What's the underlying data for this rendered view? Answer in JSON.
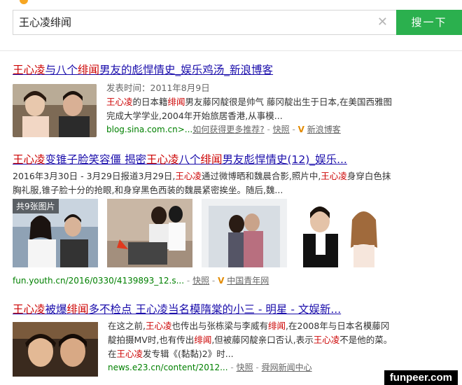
{
  "search": {
    "query": "王心凌绯闻",
    "button_label": "搜一下"
  },
  "results": [
    {
      "title_parts": [
        {
          "text": "王心凌",
          "hl": true
        },
        {
          "text": "与八个",
          "hl": false
        },
        {
          "text": "绯闻",
          "hl": true
        },
        {
          "text": "男友的彪悍情史_娱乐鸡汤_新浪博客",
          "hl": false
        }
      ],
      "date_line": "发表时间：2011年8月9日",
      "snippet_parts": [
        {
          "text": "王心凌",
          "hl": true
        },
        {
          "text": "的日本籍",
          "hl": false
        },
        {
          "text": "绯闻",
          "hl": true
        },
        {
          "text": "男友藤冈靛很是帅气 藤冈靛出生于日本,在美国西雅图完成大学学业,2004年开始旅居香港,从事模...",
          "hl": false
        }
      ],
      "url": "blog.sina.com.cn>...",
      "extra_link": "如何获得更多推荐?",
      "cache": "快照",
      "source": "新浪博客"
    },
    {
      "title_parts": [
        {
          "text": "王心凌",
          "hl": true
        },
        {
          "text": "变锥子脸笑容僵 揭密",
          "hl": false
        },
        {
          "text": "王心凌",
          "hl": true
        },
        {
          "text": "八个",
          "hl": false
        },
        {
          "text": "绯闻",
          "hl": true
        },
        {
          "text": "男友彪悍情史(12)_娱乐...",
          "hl": false
        }
      ],
      "snippet_parts": [
        {
          "text": "2016年3月30日 - 3月29日报道3月29日,",
          "hl": false
        },
        {
          "text": "王心凌",
          "hl": true
        },
        {
          "text": "通过微博晒和魏晨合影,照片中,",
          "hl": false
        },
        {
          "text": "王心凌",
          "hl": true
        },
        {
          "text": "身穿白色抹胸礼服,锥子脸十分的抢眼,和身穿黑色西装的魏晨紧密挨坐。随后,魏...",
          "hl": false
        }
      ],
      "image_count": "共9张图片",
      "url": "fun.youth.cn/2016/0330/4139893_12.s...",
      "cache": "快照",
      "source": "中国青年网"
    },
    {
      "title_parts": [
        {
          "text": "王心凌",
          "hl": true
        },
        {
          "text": "被爆",
          "hl": false
        },
        {
          "text": "绯闻",
          "hl": true
        },
        {
          "text": "多不检点 王心凌当名模隋棠的小三 - 明星 - 文娱新...",
          "hl": false
        }
      ],
      "snippet_parts": [
        {
          "text": "在这之前,",
          "hl": false
        },
        {
          "text": "王心凌",
          "hl": true
        },
        {
          "text": "也传出与张栋梁与李威有",
          "hl": false
        },
        {
          "text": "绯闻",
          "hl": true
        },
        {
          "text": ",在2008年与日本名模藤冈靛拍摄MV时,也有传出",
          "hl": false
        },
        {
          "text": "绯闻",
          "hl": true
        },
        {
          "text": ",但被藤冈靛亲口否认,表示",
          "hl": false
        },
        {
          "text": "王心凌",
          "hl": true
        },
        {
          "text": "不是他的菜。 在",
          "hl": false
        },
        {
          "text": "王心凌",
          "hl": true
        },
        {
          "text": "发专辑《(黏黏)2》时...",
          "hl": false
        }
      ],
      "url": "news.e23.cn/content/2012...",
      "cache": "快照",
      "source": "舜网新闻中心"
    }
  ],
  "watermark": "funpeer.com"
}
